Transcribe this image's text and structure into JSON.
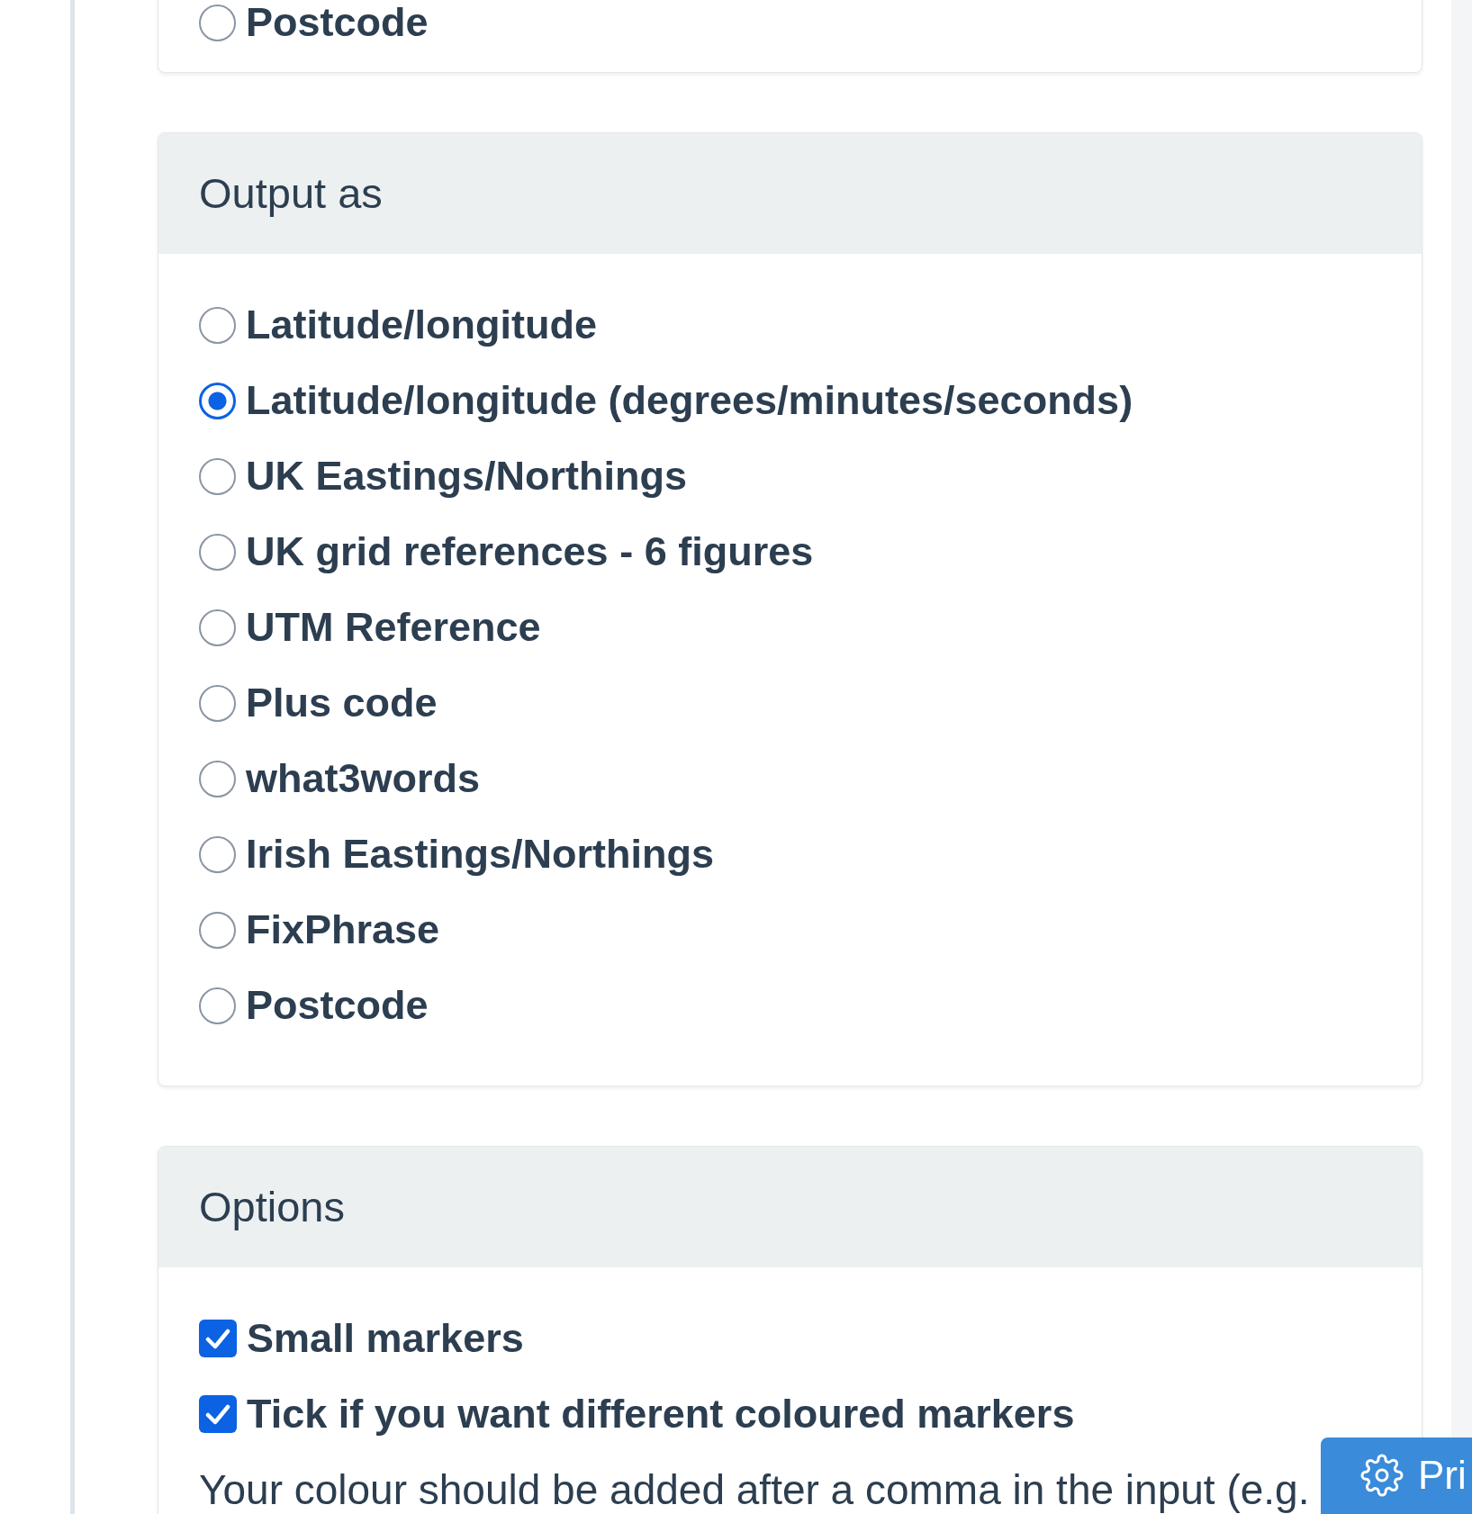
{
  "previous_card": {
    "options": [
      {
        "label": "Postcode",
        "selected": false
      }
    ]
  },
  "output_as": {
    "title": "Output as",
    "options": [
      {
        "label": "Latitude/longitude",
        "selected": false
      },
      {
        "label": "Latitude/longitude (degrees/minutes/seconds)",
        "selected": true
      },
      {
        "label": "UK Eastings/Northings",
        "selected": false
      },
      {
        "label": "UK grid references - 6 figures",
        "selected": false
      },
      {
        "label": "UTM Reference",
        "selected": false
      },
      {
        "label": "Plus code",
        "selected": false
      },
      {
        "label": "what3words",
        "selected": false
      },
      {
        "label": "Irish Eastings/Northings",
        "selected": false
      },
      {
        "label": "FixPhrase",
        "selected": false
      },
      {
        "label": "Postcode",
        "selected": false
      }
    ]
  },
  "options": {
    "title": "Options",
    "checkboxes": [
      {
        "label": "Small markers",
        "checked": true
      },
      {
        "label": "Tick if you want different coloured markers",
        "checked": true
      }
    ],
    "help_text": "Your colour should be added after a comma in the input (e.g."
  },
  "print_button": {
    "label": "Pri"
  }
}
